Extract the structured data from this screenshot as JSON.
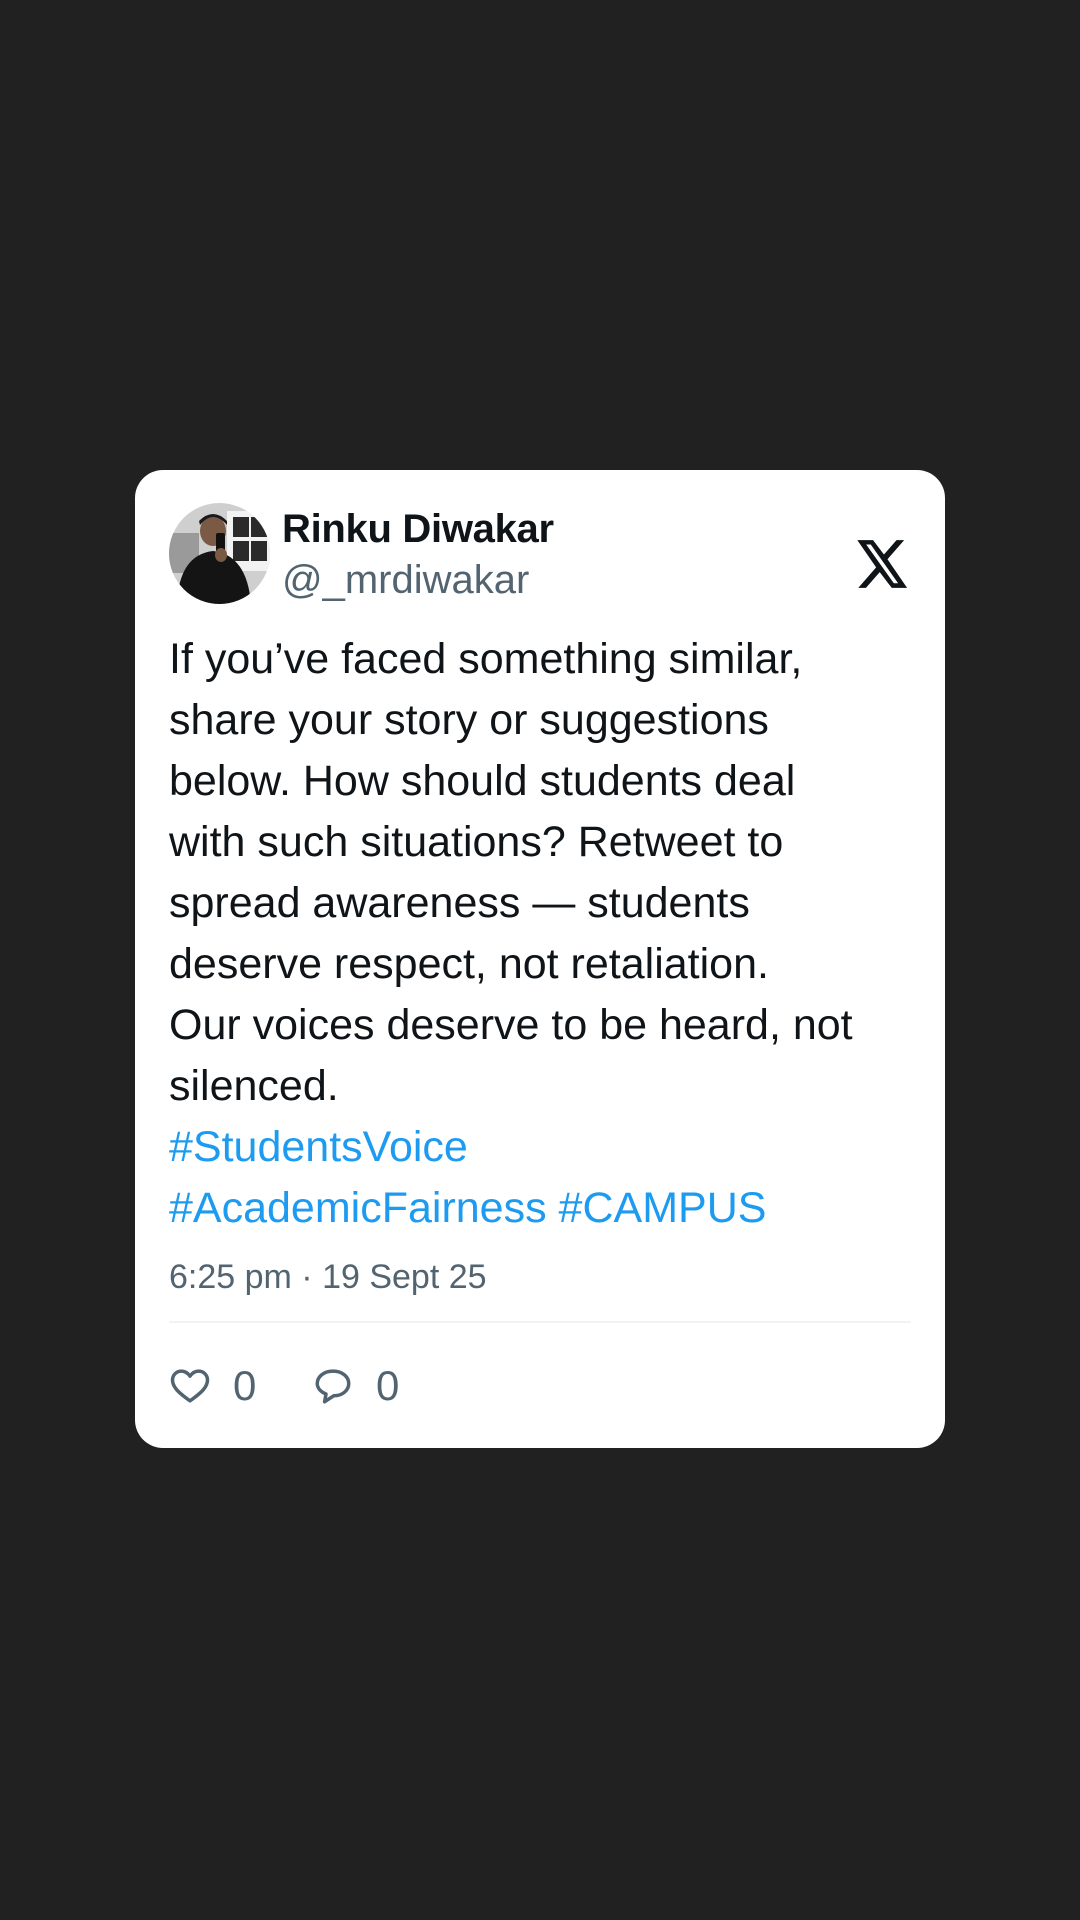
{
  "tweet": {
    "author_name": "Rinku Diwakar",
    "author_handle": "@_mrdiwakar",
    "text_lines": [
      "If you’ve faced something similar,",
      "share your story or suggestions",
      "below. How should students deal",
      "with such situations? Retweet to",
      "spread awareness — students",
      "deserve respect, not retaliation.",
      "Our voices deserve to be heard, not",
      "silenced."
    ],
    "hashtags": [
      "#StudentsVoice",
      "#AcademicFairness",
      "#CAMPUS"
    ],
    "timestamp": "6:25 pm · 19 Sept 25",
    "likes": "0",
    "replies": "0"
  },
  "icons": {
    "brand": "x-logo-icon",
    "like": "heart-icon",
    "reply": "speech-bubble-icon"
  },
  "colors": {
    "background": "#212121",
    "card": "#ffffff",
    "text": "#0f1419",
    "muted": "#536471",
    "hashtag": "#1d9bf0"
  }
}
